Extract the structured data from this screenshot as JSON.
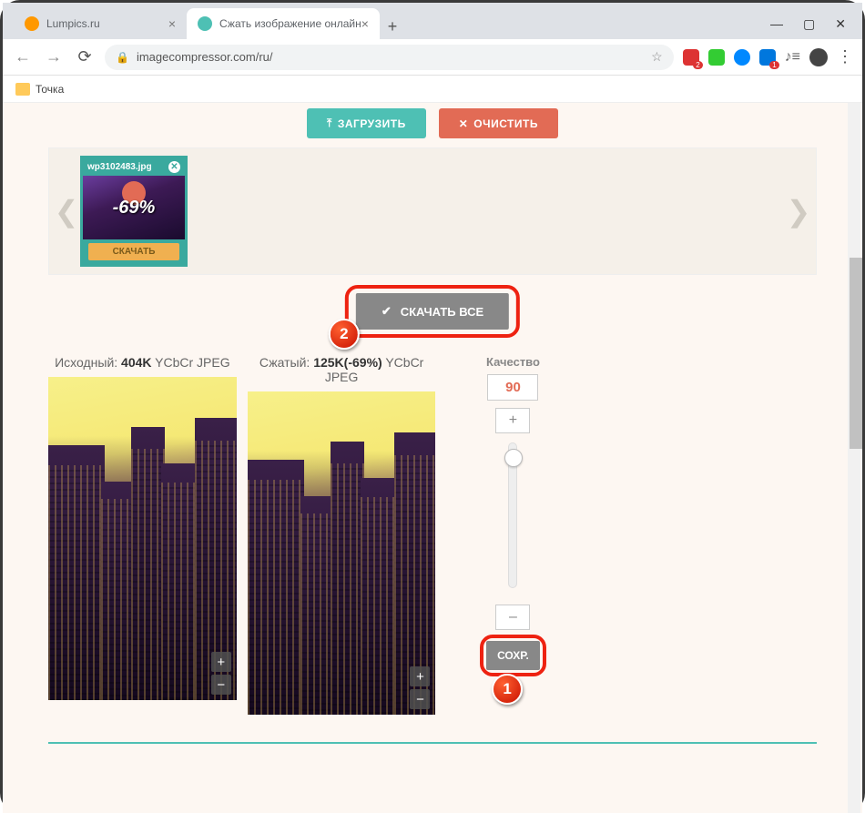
{
  "browser": {
    "tabs": [
      {
        "label": "Lumpics.ru",
        "favicon": "orange"
      },
      {
        "label": "Сжать изображение онлайн",
        "favicon": "teal"
      }
    ],
    "url": "imagecompressor.com/ru/",
    "bookmarks": {
      "folder1": "Точка"
    },
    "ext_badge_1": "2",
    "ext_badge_2": "1"
  },
  "page": {
    "upload_btn": "ЗАГРУЗИТЬ",
    "clear_btn": "ОЧИСТИТЬ",
    "thumb": {
      "filename": "wp3102483.jpg",
      "reduction": "-69%",
      "download": "СКАЧАТЬ"
    },
    "download_all": "СКАЧАТЬ ВСЕ",
    "original": {
      "prefix": "Исходный:",
      "size": "404K",
      "meta": "YCbCr JPEG"
    },
    "compressed": {
      "prefix": "Сжатый:",
      "size": "125K",
      "pct": "(-69%)",
      "meta": "YCbCr JPEG"
    },
    "quality": {
      "label": "Качество",
      "value": "90",
      "plus": "+",
      "minus": "–"
    },
    "save_btn": "СОХР.",
    "callout1": "1",
    "callout2": "2"
  }
}
